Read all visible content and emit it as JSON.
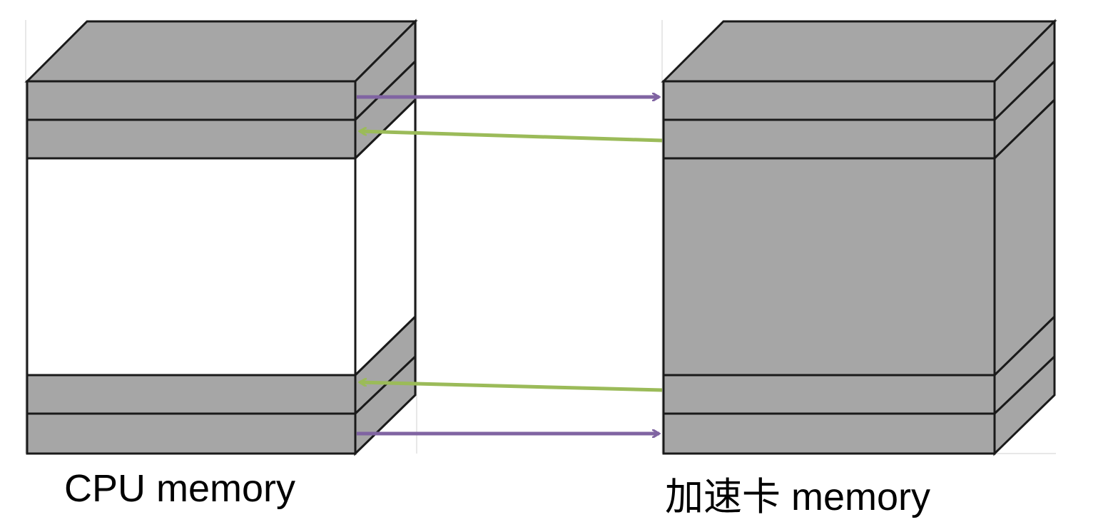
{
  "diagram": {
    "cpu_memory": {
      "label": "CPU memory"
    },
    "accelerator_memory": {
      "label": "加速卡 memory"
    },
    "colors": {
      "block_fill": "#a6a6a6",
      "top_fill": "#a6a6a6",
      "side_fill": "#a6a6a6",
      "empty_fill": "#ffffff",
      "outline": "#1a1a1a",
      "arrow_cpu_to_accelerator": "#8064a2",
      "arrow_accelerator_to_cpu": "#9bbb59"
    },
    "transfers": [
      {
        "direction": "cpu-to-accelerator",
        "region": "top-1"
      },
      {
        "direction": "accelerator-to-cpu",
        "region": "top-2"
      },
      {
        "direction": "accelerator-to-cpu",
        "region": "bottom-2"
      },
      {
        "direction": "cpu-to-accelerator",
        "region": "bottom-1"
      }
    ]
  }
}
